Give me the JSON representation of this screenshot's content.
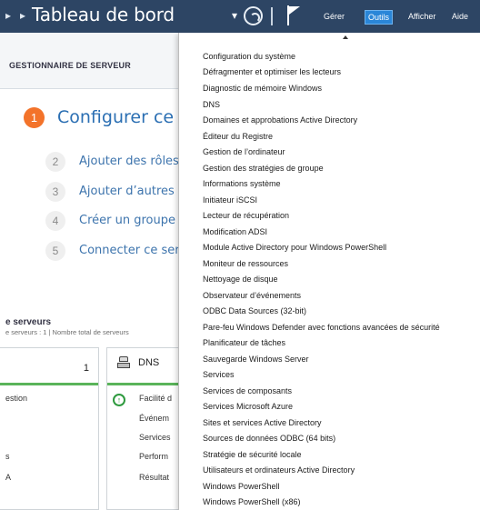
{
  "titlebar": {
    "title": "Tableau de bord",
    "menus": [
      "Gérer",
      "Outils",
      "Afficher",
      "Aide"
    ],
    "active_menu": "Outils"
  },
  "dashboard": {
    "header": "GESTIONNAIRE DE SERVEUR",
    "start_number": "1",
    "start_title": "Configurer ce se",
    "steps": [
      {
        "num": "2",
        "label": "Ajouter des rôles"
      },
      {
        "num": "3",
        "label": "Ajouter d’autres s"
      },
      {
        "num": "4",
        "label": "Créer un groupe"
      },
      {
        "num": "5",
        "label": "Connecter ce ser"
      }
    ],
    "servers_title": "e serveurs",
    "servers_subtitle": "e serveurs : 1  |  Nombre total de serveurs",
    "left_tile": {
      "count": "1",
      "rows": [
        "estion",
        "s",
        "A"
      ]
    },
    "dns_tile": {
      "name": "DNS",
      "rows": [
        "Facilité d",
        "Événem",
        "Services",
        "Perform",
        "Résultat"
      ]
    }
  },
  "tools_menu": {
    "items": [
      "Configuration du système",
      "Défragmenter et optimiser les lecteurs",
      "Diagnostic de mémoire Windows",
      "DNS",
      "Domaines et approbations Active Directory",
      "Éditeur du Registre",
      "Gestion de l’ordinateur",
      "Gestion des stratégies de groupe",
      "Informations système",
      "Initiateur iSCSI",
      "Lecteur de récupération",
      "Modification ADSI",
      "Module Active Directory pour Windows PowerShell",
      "Moniteur de ressources",
      "Nettoyage de disque",
      "Observateur d’événements",
      "ODBC Data Sources (32-bit)",
      "Pare-feu Windows Defender avec fonctions avancées de sécurité",
      "Planificateur de tâches",
      "Sauvegarde Windows Server",
      "Services",
      "Services de composants",
      "Services Microsoft Azure",
      "Sites et services Active Directory",
      "Sources de données ODBC (64 bits)",
      "Stratégie de sécurité locale",
      "Utilisateurs et ordinateurs Active Directory",
      "Windows PowerShell",
      "Windows PowerShell (x86)"
    ]
  }
}
